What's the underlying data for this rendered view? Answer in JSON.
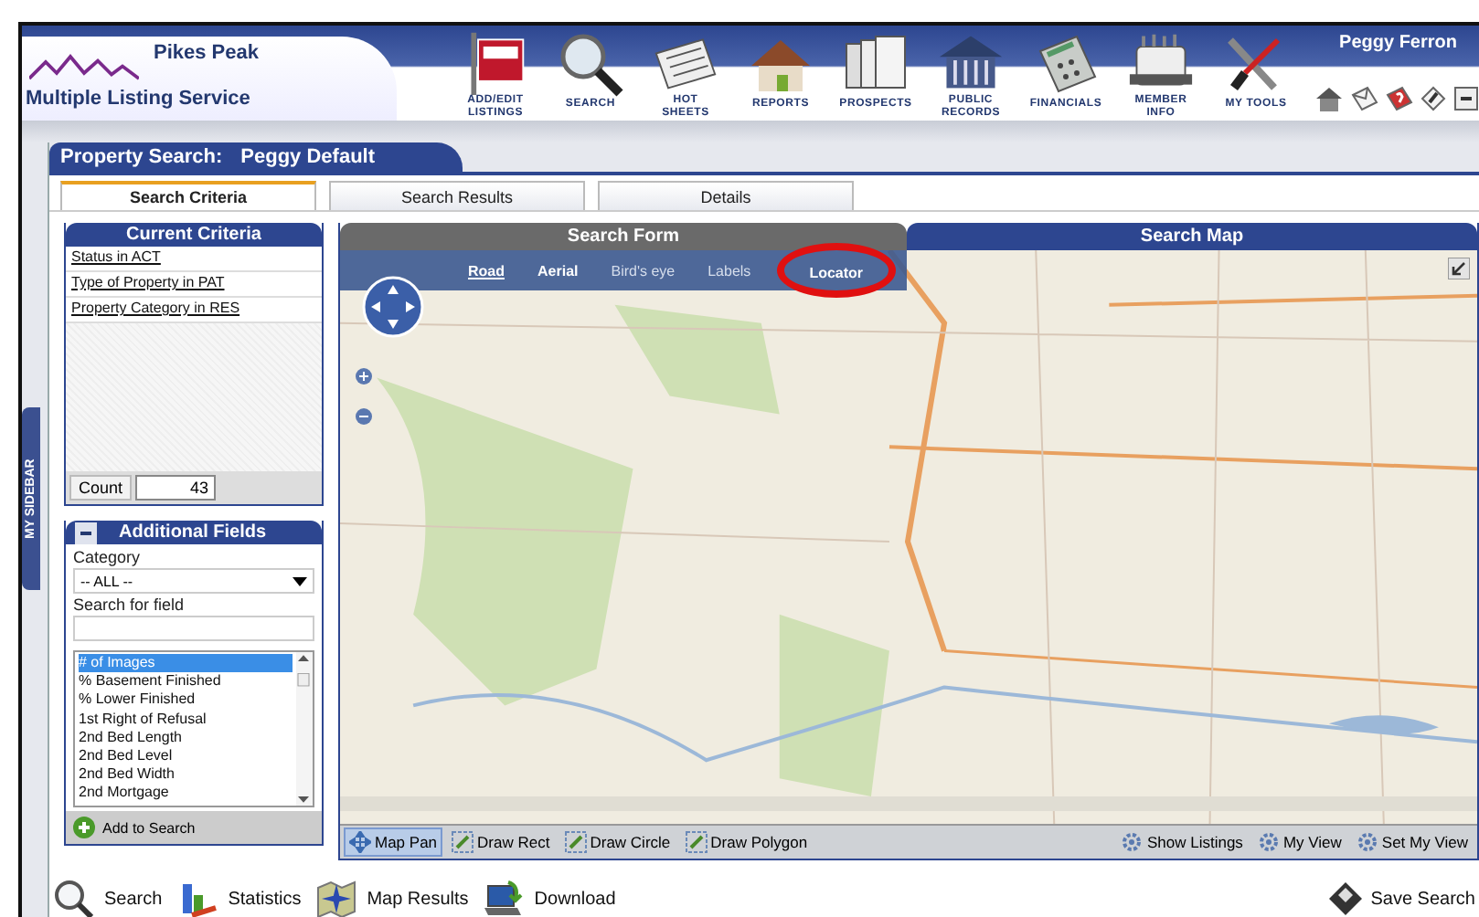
{
  "header": {
    "logo": {
      "line1": "Pikes Peak",
      "line2": "Multiple Listing Service"
    },
    "nav": [
      {
        "lines": [
          "ADD/EDIT",
          "LISTINGS"
        ],
        "kind": "sign"
      },
      {
        "lines": [
          "SEARCH"
        ],
        "kind": "magnifier"
      },
      {
        "lines": [
          "HOT",
          "SHEETS"
        ],
        "kind": "newspaper"
      },
      {
        "lines": [
          "REPORTS"
        ],
        "kind": "house"
      },
      {
        "lines": [
          "PROSPECTS"
        ],
        "kind": "folders"
      },
      {
        "lines": [
          "PUBLIC",
          "RECORDS"
        ],
        "kind": "building"
      },
      {
        "lines": [
          "FINANCIALS"
        ],
        "kind": "calculator"
      },
      {
        "lines": [
          "MEMBER",
          "INFO"
        ],
        "kind": "rolodex"
      },
      {
        "lines": [
          "MY TOOLS"
        ],
        "kind": "tools"
      }
    ],
    "user": "Peggy Ferron",
    "quick": [
      {
        "kind": "home"
      },
      {
        "kind": "mail"
      },
      {
        "kind": "help"
      },
      {
        "kind": "edit"
      },
      {
        "kind": "minimize"
      }
    ]
  },
  "page": {
    "title": "Property Search:",
    "profile": "Peggy Default"
  },
  "sidebar_tab": "MY SIDEBAR",
  "tabs": [
    {
      "label": "Search Criteria",
      "selected": true
    },
    {
      "label": "Search Results",
      "selected": false
    },
    {
      "label": "Details",
      "selected": false
    }
  ],
  "current_criteria": {
    "title": "Current Criteria",
    "items": [
      "Status in ACT",
      "Type of Property in PAT",
      "Property Category in RES"
    ],
    "count_label": "Count",
    "count": "43"
  },
  "additional_fields": {
    "title": "Additional Fields",
    "expanded": true,
    "category_label": "Category",
    "category": "-- ALL --",
    "search_label": "Search for field",
    "fields": [
      {
        "label": "# of Images",
        "selected": true
      },
      {
        "label": "% Basement Finished",
        "selected": false
      },
      {
        "label": "% Lower Finished",
        "selected": false
      },
      {
        "label": "1st Right of Refusal",
        "selected": false
      },
      {
        "label": "2nd Bed Length",
        "selected": false
      },
      {
        "label": "2nd Bed Level",
        "selected": false
      },
      {
        "label": "2nd Bed Width",
        "selected": false
      },
      {
        "label": "2nd Mortgage",
        "selected": false
      }
    ],
    "add_button": "Add to Search"
  },
  "search_form": {
    "title": "Search Form"
  },
  "search_map": {
    "title": "Search Map",
    "map_modes": [
      {
        "label": "Road",
        "selected": true,
        "disabled": false,
        "highlighted": false
      },
      {
        "label": "Aerial",
        "selected": false,
        "disabled": false,
        "highlighted": false
      },
      {
        "label": "Bird's eye",
        "selected": false,
        "disabled": true,
        "highlighted": false
      },
      {
        "label": "Labels",
        "selected": false,
        "disabled": true,
        "highlighted": false
      },
      {
        "label": "Locator",
        "selected": false,
        "disabled": false,
        "highlighted": true
      }
    ],
    "tools": [
      {
        "label": "Map Pan",
        "selected": true,
        "kind": "pan"
      },
      {
        "label": "Draw Rect",
        "selected": false,
        "kind": "draw"
      },
      {
        "label": "Draw Circle",
        "selected": false,
        "kind": "draw"
      },
      {
        "label": "Draw Polygon",
        "selected": false,
        "kind": "draw"
      }
    ],
    "view_tools": [
      {
        "label": "Show Listings"
      },
      {
        "label": "My View"
      },
      {
        "label": "Set My View"
      }
    ]
  },
  "actions": [
    {
      "label": "Search",
      "kind": "search"
    },
    {
      "label": "Statistics",
      "kind": "statistics"
    },
    {
      "label": "Map Results",
      "kind": "map"
    },
    {
      "label": "Download",
      "kind": "download"
    }
  ],
  "save_action": {
    "label": "Save Search"
  }
}
